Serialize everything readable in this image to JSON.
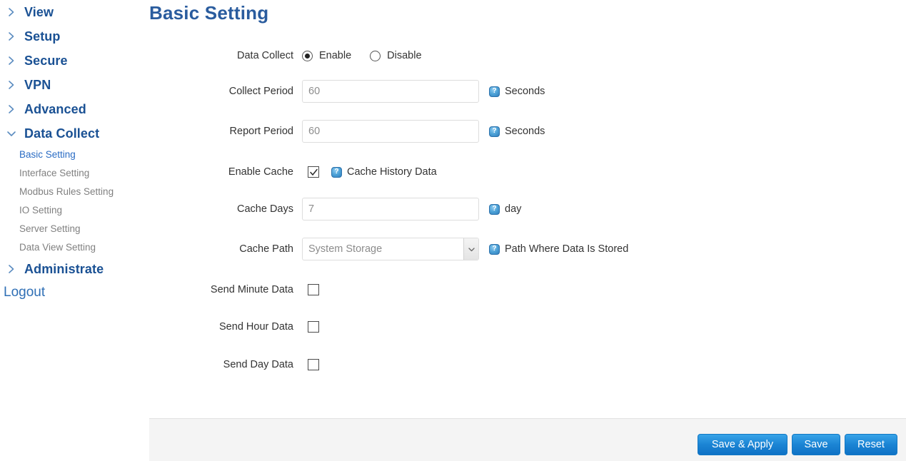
{
  "sidebar": {
    "top_items": [
      {
        "label": "View",
        "icon": "chevron-right-icon",
        "expanded": false
      },
      {
        "label": "Setup",
        "icon": "chevron-right-icon",
        "expanded": false
      },
      {
        "label": "Secure",
        "icon": "chevron-right-icon",
        "expanded": false
      },
      {
        "label": "VPN",
        "icon": "chevron-right-icon",
        "expanded": false
      },
      {
        "label": "Advanced",
        "icon": "chevron-right-icon",
        "expanded": false
      },
      {
        "label": "Data Collect",
        "icon": "chevron-down-icon",
        "expanded": true
      }
    ],
    "sub_items": [
      {
        "label": "Basic Setting",
        "active": true
      },
      {
        "label": "Interface Setting",
        "active": false
      },
      {
        "label": "Modbus Rules Setting",
        "active": false
      },
      {
        "label": "IO Setting",
        "active": false
      },
      {
        "label": "Server Setting",
        "active": false
      },
      {
        "label": "Data View Setting",
        "active": false
      }
    ],
    "administrate": {
      "label": "Administrate",
      "icon": "chevron-right-icon"
    },
    "logout": "Logout",
    "colors": {
      "top_label": "#1a5194",
      "active_sub": "#2a6cc4",
      "inactive_sub": "#808080",
      "logout": "#2f6fb5"
    }
  },
  "page": {
    "title": "Basic Setting",
    "title_color": "#2a5c9e"
  },
  "form": {
    "data_collect": {
      "label": "Data Collect",
      "enable_label": "Enable",
      "disable_label": "Disable",
      "selected": "Enable"
    },
    "collect_period": {
      "label": "Collect Period",
      "value": "",
      "placeholder": "60",
      "hint": "Seconds",
      "help_icon": "help-question-icon"
    },
    "report_period": {
      "label": "Report Period",
      "value": "",
      "placeholder": "60",
      "hint": "Seconds",
      "help_icon": "help-question-icon"
    },
    "enable_cache": {
      "label": "Enable Cache",
      "checked": true,
      "hint": "Cache History Data",
      "help_icon": "help-question-icon"
    },
    "cache_days": {
      "label": "Cache Days",
      "value": "",
      "placeholder": "7",
      "hint": "day",
      "help_icon": "help-question-icon"
    },
    "cache_path": {
      "label": "Cache Path",
      "selected": "System Storage",
      "options": [
        "System Storage"
      ],
      "hint": "Path Where Data Is Stored",
      "help_icon": "help-question-icon",
      "dropdown_icon": "chevron-down-icon"
    },
    "send_minute_data": {
      "label": "Send Minute Data",
      "checked": false
    },
    "send_hour_data": {
      "label": "Send Hour Data",
      "checked": false
    },
    "send_day_data": {
      "label": "Send Day Data",
      "checked": false
    }
  },
  "footer": {
    "save_apply_label": "Save & Apply",
    "save_label": "Save",
    "reset_label": "Reset",
    "button_color": "#1b84d4"
  }
}
